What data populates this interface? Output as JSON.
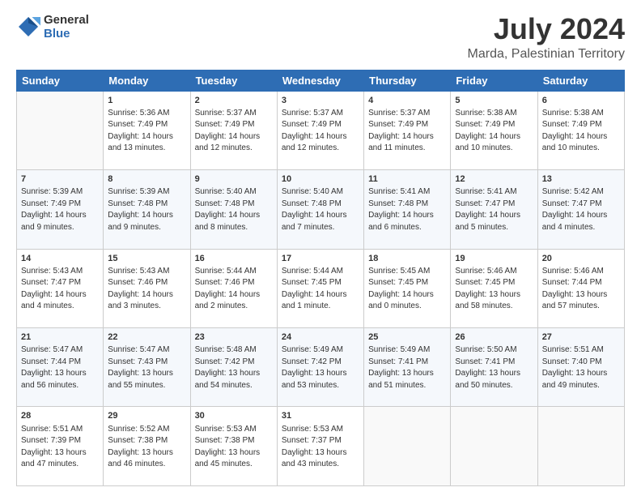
{
  "header": {
    "logo_line1": "General",
    "logo_line2": "Blue",
    "title": "July 2024",
    "subtitle": "Marda, Palestinian Territory"
  },
  "columns": [
    "Sunday",
    "Monday",
    "Tuesday",
    "Wednesday",
    "Thursday",
    "Friday",
    "Saturday"
  ],
  "weeks": [
    [
      {
        "day": "",
        "text": ""
      },
      {
        "day": "1",
        "text": "Sunrise: 5:36 AM\nSunset: 7:49 PM\nDaylight: 14 hours\nand 13 minutes."
      },
      {
        "day": "2",
        "text": "Sunrise: 5:37 AM\nSunset: 7:49 PM\nDaylight: 14 hours\nand 12 minutes."
      },
      {
        "day": "3",
        "text": "Sunrise: 5:37 AM\nSunset: 7:49 PM\nDaylight: 14 hours\nand 12 minutes."
      },
      {
        "day": "4",
        "text": "Sunrise: 5:37 AM\nSunset: 7:49 PM\nDaylight: 14 hours\nand 11 minutes."
      },
      {
        "day": "5",
        "text": "Sunrise: 5:38 AM\nSunset: 7:49 PM\nDaylight: 14 hours\nand 10 minutes."
      },
      {
        "day": "6",
        "text": "Sunrise: 5:38 AM\nSunset: 7:49 PM\nDaylight: 14 hours\nand 10 minutes."
      }
    ],
    [
      {
        "day": "7",
        "text": "Sunrise: 5:39 AM\nSunset: 7:49 PM\nDaylight: 14 hours\nand 9 minutes."
      },
      {
        "day": "8",
        "text": "Sunrise: 5:39 AM\nSunset: 7:48 PM\nDaylight: 14 hours\nand 9 minutes."
      },
      {
        "day": "9",
        "text": "Sunrise: 5:40 AM\nSunset: 7:48 PM\nDaylight: 14 hours\nand 8 minutes."
      },
      {
        "day": "10",
        "text": "Sunrise: 5:40 AM\nSunset: 7:48 PM\nDaylight: 14 hours\nand 7 minutes."
      },
      {
        "day": "11",
        "text": "Sunrise: 5:41 AM\nSunset: 7:48 PM\nDaylight: 14 hours\nand 6 minutes."
      },
      {
        "day": "12",
        "text": "Sunrise: 5:41 AM\nSunset: 7:47 PM\nDaylight: 14 hours\nand 5 minutes."
      },
      {
        "day": "13",
        "text": "Sunrise: 5:42 AM\nSunset: 7:47 PM\nDaylight: 14 hours\nand 4 minutes."
      }
    ],
    [
      {
        "day": "14",
        "text": "Sunrise: 5:43 AM\nSunset: 7:47 PM\nDaylight: 14 hours\nand 4 minutes."
      },
      {
        "day": "15",
        "text": "Sunrise: 5:43 AM\nSunset: 7:46 PM\nDaylight: 14 hours\nand 3 minutes."
      },
      {
        "day": "16",
        "text": "Sunrise: 5:44 AM\nSunset: 7:46 PM\nDaylight: 14 hours\nand 2 minutes."
      },
      {
        "day": "17",
        "text": "Sunrise: 5:44 AM\nSunset: 7:45 PM\nDaylight: 14 hours\nand 1 minute."
      },
      {
        "day": "18",
        "text": "Sunrise: 5:45 AM\nSunset: 7:45 PM\nDaylight: 14 hours\nand 0 minutes."
      },
      {
        "day": "19",
        "text": "Sunrise: 5:46 AM\nSunset: 7:45 PM\nDaylight: 13 hours\nand 58 minutes."
      },
      {
        "day": "20",
        "text": "Sunrise: 5:46 AM\nSunset: 7:44 PM\nDaylight: 13 hours\nand 57 minutes."
      }
    ],
    [
      {
        "day": "21",
        "text": "Sunrise: 5:47 AM\nSunset: 7:44 PM\nDaylight: 13 hours\nand 56 minutes."
      },
      {
        "day": "22",
        "text": "Sunrise: 5:47 AM\nSunset: 7:43 PM\nDaylight: 13 hours\nand 55 minutes."
      },
      {
        "day": "23",
        "text": "Sunrise: 5:48 AM\nSunset: 7:42 PM\nDaylight: 13 hours\nand 54 minutes."
      },
      {
        "day": "24",
        "text": "Sunrise: 5:49 AM\nSunset: 7:42 PM\nDaylight: 13 hours\nand 53 minutes."
      },
      {
        "day": "25",
        "text": "Sunrise: 5:49 AM\nSunset: 7:41 PM\nDaylight: 13 hours\nand 51 minutes."
      },
      {
        "day": "26",
        "text": "Sunrise: 5:50 AM\nSunset: 7:41 PM\nDaylight: 13 hours\nand 50 minutes."
      },
      {
        "day": "27",
        "text": "Sunrise: 5:51 AM\nSunset: 7:40 PM\nDaylight: 13 hours\nand 49 minutes."
      }
    ],
    [
      {
        "day": "28",
        "text": "Sunrise: 5:51 AM\nSunset: 7:39 PM\nDaylight: 13 hours\nand 47 minutes."
      },
      {
        "day": "29",
        "text": "Sunrise: 5:52 AM\nSunset: 7:38 PM\nDaylight: 13 hours\nand 46 minutes."
      },
      {
        "day": "30",
        "text": "Sunrise: 5:53 AM\nSunset: 7:38 PM\nDaylight: 13 hours\nand 45 minutes."
      },
      {
        "day": "31",
        "text": "Sunrise: 5:53 AM\nSunset: 7:37 PM\nDaylight: 13 hours\nand 43 minutes."
      },
      {
        "day": "",
        "text": ""
      },
      {
        "day": "",
        "text": ""
      },
      {
        "day": "",
        "text": ""
      }
    ]
  ]
}
